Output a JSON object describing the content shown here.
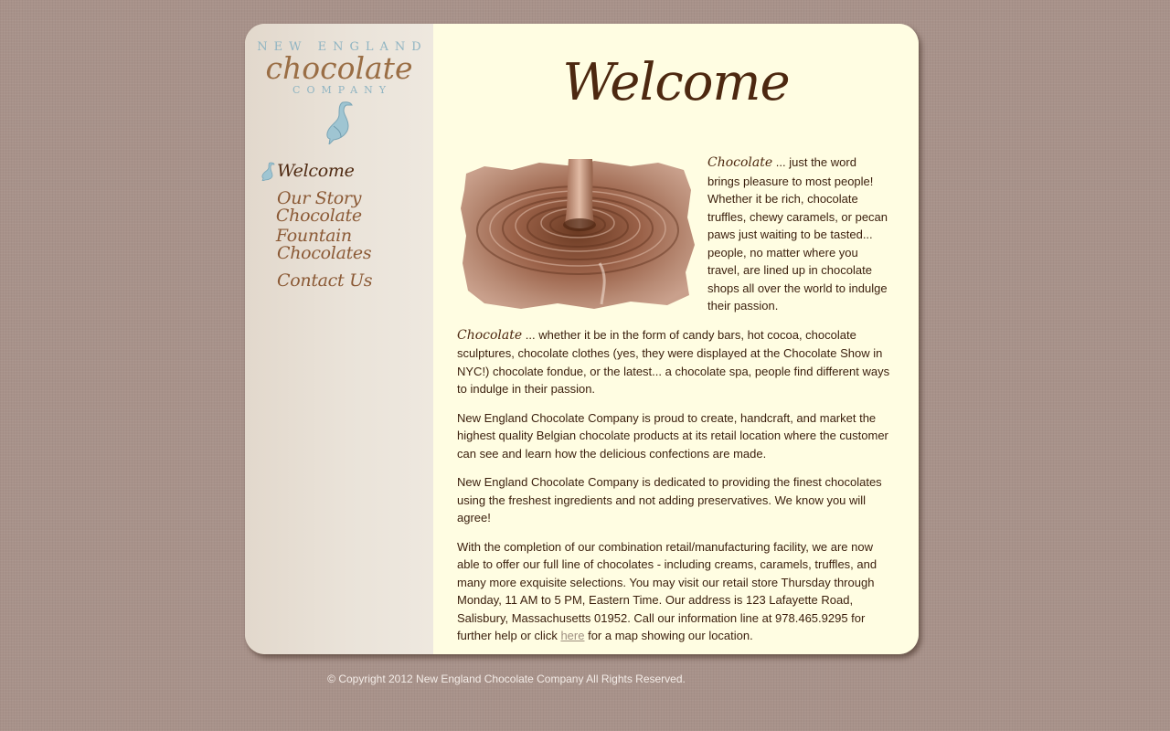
{
  "brand": {
    "line1": "NEW ENGLAND",
    "line2": "chocolate",
    "line3": "COMPANY"
  },
  "nav": {
    "items": [
      {
        "label": "Welcome",
        "active": true
      },
      {
        "label": "Our Story",
        "active": false
      },
      {
        "label": "Chocolate Fountain",
        "active": false
      },
      {
        "label": "Chocolates",
        "active": false
      },
      {
        "label": "Contact Us",
        "active": false
      }
    ]
  },
  "main": {
    "title": "Welcome",
    "p1_word": "Chocolate",
    "p1_text": " ... just the word brings pleasure to most people! Whether it be rich, chocolate truffles, chewy caramels, or pecan paws just waiting to be tasted... people, no matter where you travel, are lined up in chocolate shops all over the world to indulge their passion.",
    "p2_word": "Chocolate",
    "p2_text": " ... whether it be in the form of candy bars, hot cocoa, chocolate sculptures, chocolate clothes (yes, they were displayed at the Chocolate Show in NYC!) chocolate fondue, or the latest... a chocolate spa, people find different ways to indulge in their passion.",
    "p3": "New England Chocolate Company is proud to create, handcraft, and market the highest quality Belgian chocolate products at its retail location where the customer can see and learn how the delicious confections are made.",
    "p4": "New England Chocolate Company is dedicated to providing the finest chocolates using the freshest ingredients and not adding preservatives. We know you will agree!",
    "p5_before": "With the completion of our combination retail/manufacturing facility, we are now able to offer our full line of chocolates - including creams, caramels, truffles, and many more exquisite selections. You may visit our retail store Thursday through Monday, 11 AM to 5 PM, Eastern Time. Our address is 123 Lafayette Road, Salisbury, Massachusetts 01952. Call our information line at 978.465.9295 for further help or click ",
    "p5_link": "here",
    "p5_after": " for a map showing our location."
  },
  "footer": {
    "copyright": "© Copyright 2012 New England Chocolate Company All Rights Reserved."
  },
  "colors": {
    "background": "#a8928a",
    "content_bg": "#fffde2",
    "sidebar_bg": "#e8e0d6",
    "nav_text": "#8b5a36",
    "heading": "#4d2810",
    "logo_blue": "#8fb4c2"
  }
}
